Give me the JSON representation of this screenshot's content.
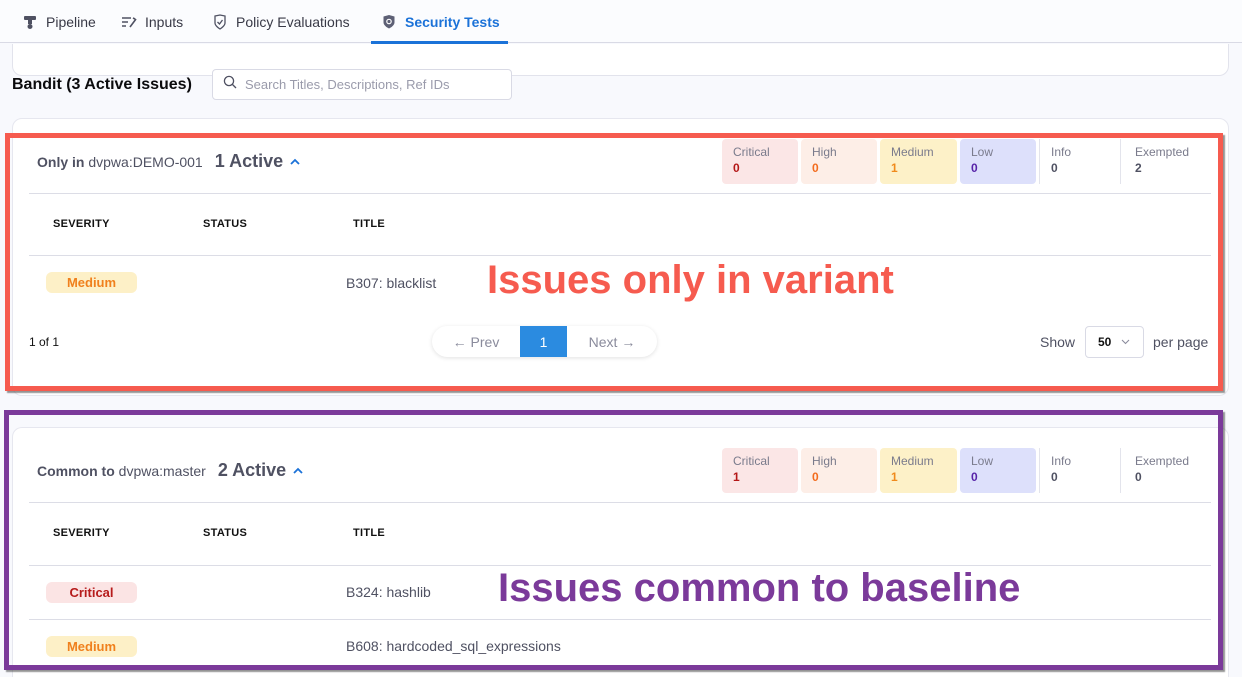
{
  "tabs": [
    {
      "label": "Pipeline",
      "icon": "pipeline-icon",
      "active": false
    },
    {
      "label": "Inputs",
      "icon": "inputs-icon",
      "active": false
    },
    {
      "label": "Policy Evaluations",
      "icon": "shield-check-icon",
      "active": false
    },
    {
      "label": "Security Tests",
      "icon": "security-shield-icon",
      "active": true
    }
  ],
  "section": {
    "title": "Bandit (3 Active Issues)",
    "search_placeholder": "Search Titles, Descriptions, Ref IDs",
    "search_value": ""
  },
  "colors": {
    "accent": "#1b72d8",
    "variant_outline": "#f65b4f",
    "baseline_outline": "#7b3a9a"
  },
  "groups": [
    {
      "label_bold": "Only in",
      "label_target": "dvpwa:DEMO-001",
      "active_count": "1 Active",
      "severity_counts": [
        {
          "name": "Critical",
          "value": "0"
        },
        {
          "name": "High",
          "value": "0"
        },
        {
          "name": "Medium",
          "value": "1"
        },
        {
          "name": "Low",
          "value": "0"
        },
        {
          "name": "Info",
          "value": "0"
        },
        {
          "name": "Exempted",
          "value": "2"
        }
      ],
      "columns": [
        "SEVERITY",
        "STATUS",
        "TITLE"
      ],
      "rows": [
        {
          "severity": "Medium",
          "status": "",
          "title": "B307: blacklist"
        }
      ],
      "pagination": {
        "info": "1 of 1",
        "prev": "← Prev",
        "current": "1",
        "next": "Next →",
        "show_label": "Show",
        "per_page_value": "50",
        "per_page_label": "per page"
      },
      "annotation": "Issues only in variant"
    },
    {
      "label_bold": "Common to",
      "label_target": "dvpwa:master",
      "active_count": "2 Active",
      "severity_counts": [
        {
          "name": "Critical",
          "value": "1"
        },
        {
          "name": "High",
          "value": "0"
        },
        {
          "name": "Medium",
          "value": "1"
        },
        {
          "name": "Low",
          "value": "0"
        },
        {
          "name": "Info",
          "value": "0"
        },
        {
          "name": "Exempted",
          "value": "0"
        }
      ],
      "columns": [
        "SEVERITY",
        "STATUS",
        "TITLE"
      ],
      "rows": [
        {
          "severity": "Critical",
          "status": "",
          "title": "B324: hashlib"
        },
        {
          "severity": "Medium",
          "status": "",
          "title": "B608: hardcoded_sql_expressions"
        }
      ],
      "annotation": "Issues common to baseline"
    }
  ]
}
